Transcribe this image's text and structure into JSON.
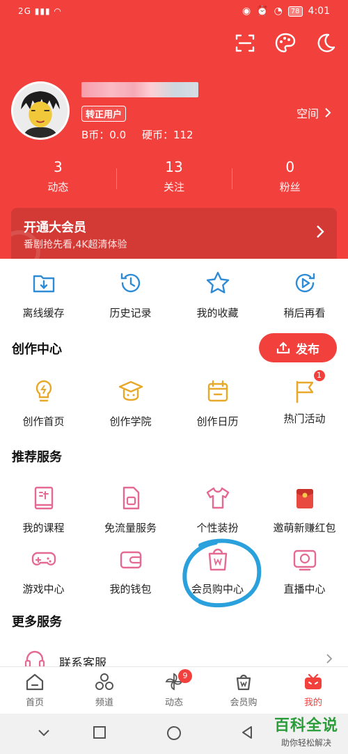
{
  "status_bar": {
    "signal": "2G",
    "battery": "78",
    "time": "4:01"
  },
  "profile": {
    "badge": "转正用户",
    "bcoin_label": "B币：",
    "bcoin_value": "0.0",
    "coin_label": "硬币：",
    "coin_value": "112",
    "space_label": "空间"
  },
  "stats": [
    {
      "value": "3",
      "label": "动态"
    },
    {
      "value": "13",
      "label": "关注"
    },
    {
      "value": "0",
      "label": "粉丝"
    }
  ],
  "vip": {
    "title": "开通大会员",
    "subtitle": "番剧抢先看,4K超清体验"
  },
  "quick_actions": [
    {
      "label": "离线缓存",
      "icon": "download-folder-icon"
    },
    {
      "label": "历史记录",
      "icon": "history-clock-icon"
    },
    {
      "label": "我的收藏",
      "icon": "star-icon"
    },
    {
      "label": "稍后再看",
      "icon": "play-later-icon"
    }
  ],
  "creation": {
    "title": "创作中心",
    "publish_label": "发布",
    "items": [
      {
        "label": "创作首页",
        "icon": "lightbulb-icon"
      },
      {
        "label": "创作学院",
        "icon": "graduation-cap-icon"
      },
      {
        "label": "创作日历",
        "icon": "calendar-icon"
      },
      {
        "label": "热门活动",
        "icon": "flag-icon",
        "badge": "1"
      }
    ]
  },
  "recommended": {
    "title": "推荐服务",
    "items": [
      {
        "label": "我的课程",
        "icon": "course-book-icon"
      },
      {
        "label": "免流量服务",
        "icon": "sim-card-icon"
      },
      {
        "label": "个性装扮",
        "icon": "tshirt-icon"
      },
      {
        "label": "邀萌新赚红包",
        "icon": "red-envelope-icon"
      },
      {
        "label": "游戏中心",
        "icon": "gamepad-icon"
      },
      {
        "label": "我的钱包",
        "icon": "wallet-icon"
      },
      {
        "label": "会员购中心",
        "icon": "shopping-bag-icon"
      },
      {
        "label": "直播中心",
        "icon": "live-tv-icon"
      }
    ]
  },
  "more": {
    "title": "更多服务",
    "items": [
      {
        "label": "联系客服",
        "icon": "headset-icon"
      }
    ]
  },
  "tabbar": [
    {
      "label": "首页",
      "icon": "home-icon"
    },
    {
      "label": "频道",
      "icon": "channel-icon"
    },
    {
      "label": "动态",
      "icon": "pinwheel-icon",
      "badge": "9"
    },
    {
      "label": "会员购",
      "icon": "shopping-bag-icon"
    },
    {
      "label": "我的",
      "icon": "tv-face-icon",
      "active": true
    }
  ],
  "watermark": {
    "title": "百科全说",
    "subtitle": "助你轻松解决"
  },
  "colors": {
    "brand_red": "#f2403d",
    "icon_blue": "#2e8bd6",
    "icon_yellow": "#e8a82a",
    "icon_pink": "#e46a93",
    "annotation": "#2aa0dc"
  }
}
